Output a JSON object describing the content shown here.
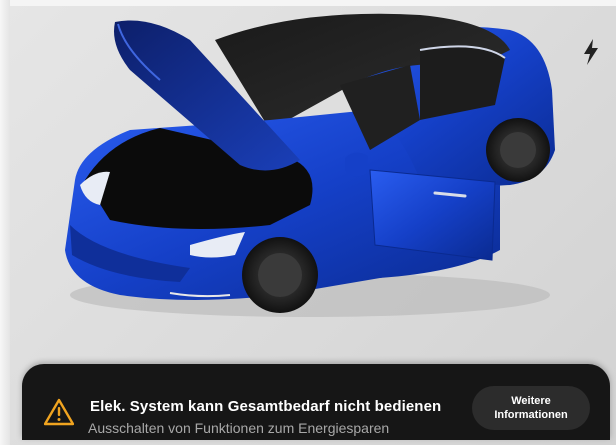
{
  "alert": {
    "title": "Elek. System kann Gesamtbedarf nicht bedienen",
    "subtitle": "Ausschalten von Funktionen zum Energiesparen",
    "button_line1": "Weitere",
    "button_line2": "Informationen",
    "icon": "warning-triangle-icon"
  },
  "status": {
    "charge_icon": "lightning-bolt-icon"
  },
  "vehicle": {
    "color": "#1540c8",
    "frunk_state": "open",
    "door_state": "open"
  },
  "colors": {
    "background": "#e2e2e2",
    "toast_background": "#161616",
    "warning": "#f0a420",
    "button_background": "#2c2c2c"
  }
}
